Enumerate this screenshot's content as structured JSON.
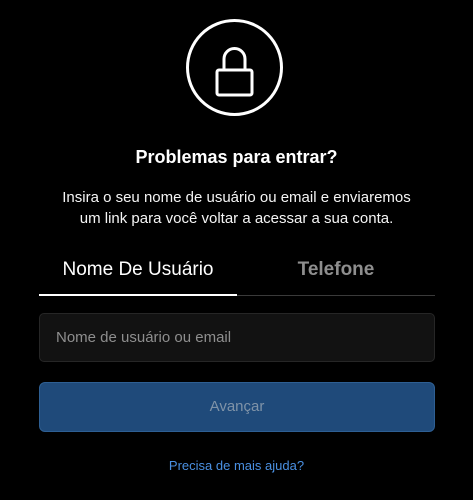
{
  "icon": "lock-icon",
  "title": "Problemas para entrar?",
  "description": "Insira o seu nome de usuário ou email e enviaremos um link para você voltar a acessar a sua conta.",
  "tabs": [
    {
      "label": "Nome De Usuário",
      "active": true
    },
    {
      "label": "Telefone",
      "active": false
    }
  ],
  "login_field": {
    "value": "",
    "placeholder": "Nome de usuário ou email"
  },
  "next_button": {
    "label": "Avançar",
    "enabled": false
  },
  "help_link": "Precisa de mais ajuda?",
  "colors": {
    "background": "#000000",
    "button": "#1f4a7a",
    "link": "#4a90e2"
  }
}
